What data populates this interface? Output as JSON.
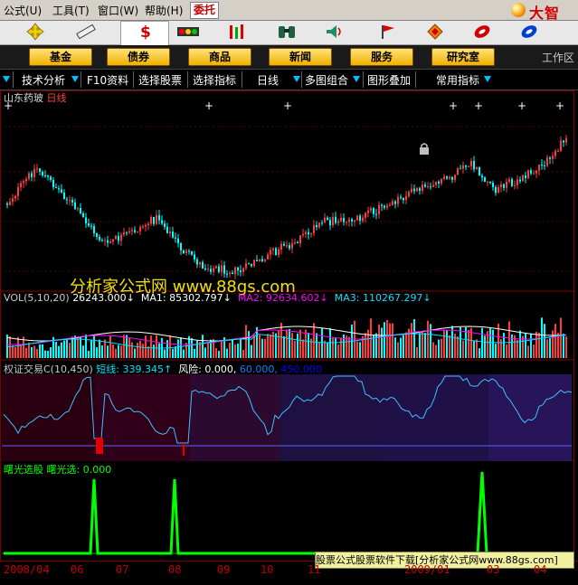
{
  "menubar": {
    "items": [
      "公式(U)",
      "工具(T)",
      "窗口(W)",
      "帮助(H)"
    ],
    "entrust": "委托",
    "logo_text": "大智"
  },
  "iconbar": {
    "icons": [
      "move-cross-icon",
      "ruler-icon",
      "dollar-icon",
      "traffic-light-icon",
      "bar-chart-icon",
      "binoculars-icon",
      "speaker-icon",
      "flag-icon",
      "diamond-icon",
      "swirl-icon-1",
      "swirl-icon-2"
    ]
  },
  "navbar": {
    "buttons": [
      "基金",
      "债券",
      "商品",
      "新闻",
      "服务",
      "研究室"
    ],
    "workspace": "工作区"
  },
  "funcbar": {
    "items": [
      "技术分析",
      "F10资料",
      "选择股票",
      "选择指标",
      "日线",
      "多图组合",
      "图形叠加",
      "常用指标"
    ]
  },
  "stock": {
    "name": "山东药玻",
    "period": "日线"
  },
  "watermark": "分析家公式网 www.88gs.com",
  "vol": {
    "title": "VOL(5,10,20)",
    "value": "26243.000↓",
    "ma1": "MA1: 85302.797↓",
    "ma2": "MA2: 92634.602↓",
    "ma3": "MA3: 110267.297↓",
    "colors": {
      "title": "#c8c8c8",
      "ma1": "#ffffff",
      "ma2": "#ff00ff",
      "ma3": "#00e0ff"
    }
  },
  "qz": {
    "title": "权证交易C(10,450)",
    "short_line": "短线: 339.345↑",
    "risk": "风险: 0.000,",
    "v1": "60.000,",
    "v2": "450.000",
    "colors": {
      "title": "#c8c8c8",
      "short": "#00e0ff",
      "risk": "#ffffff",
      "v1": "#0080ff",
      "v2": "#0000ff"
    }
  },
  "sg": {
    "title": "曙光选股",
    "value": "曙光选: 0.000",
    "color": "#00ff00"
  },
  "download_bar": "股票公式股票软件下载[分析家公式网www.88gs.com]",
  "dates": [
    "2008/04",
    "06",
    "07",
    "08",
    "09",
    "10",
    "11",
    "2009/01",
    "03",
    "04"
  ],
  "colors": {
    "up": "#ff3c3c",
    "down": "#00ffff",
    "grid": "#800000",
    "sg_line": "#00ff00",
    "qz_line": "#40c0ff"
  }
}
